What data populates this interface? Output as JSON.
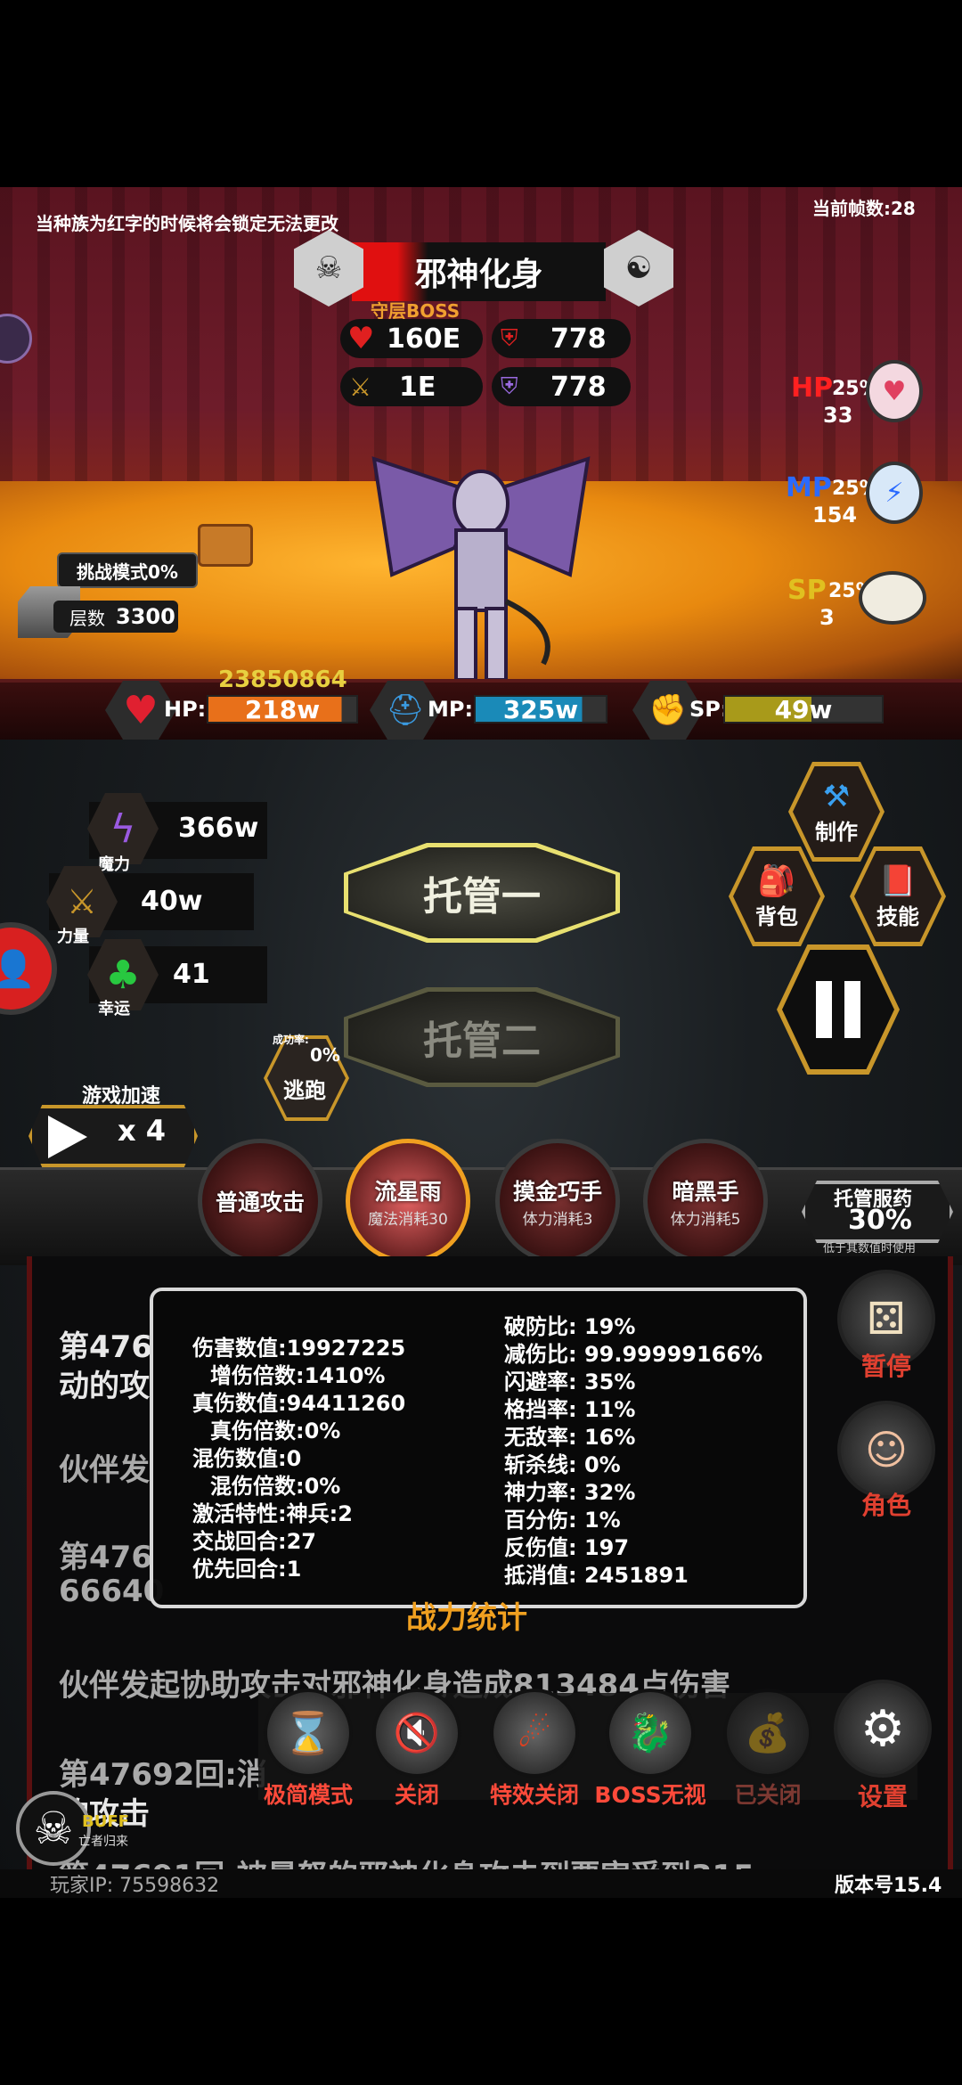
{
  "top_notice": "当种族为红字的时候将会锁定无法更改",
  "fps_label": "当前帧数:28",
  "boss": {
    "name": "邪神化身",
    "tag": "守层BOSS",
    "hp": "160E",
    "atk": "1E",
    "def1": "778",
    "def2": "778"
  },
  "potions": [
    {
      "type": "HP",
      "pct": "25%",
      "count": "33"
    },
    {
      "type": "MP",
      "pct": "25%",
      "count": "154"
    },
    {
      "type": "SP",
      "pct": "25%",
      "count": "3"
    }
  ],
  "challenge": {
    "mode": "挑战模式0%",
    "floor_label": "层数",
    "floor": "3300"
  },
  "player": {
    "score": "23850864",
    "hp_label": "HP:",
    "hp": "218w",
    "hp_fill": 0.9,
    "mp_label": "MP:",
    "mp": "325w",
    "mp_fill": 0.82,
    "sp_label": "SP:",
    "sp": "49w",
    "sp_fill": 0.55
  },
  "attributes": [
    {
      "label": "魔力",
      "value": "366w",
      "icon": "lightning-icon"
    },
    {
      "label": "力量",
      "value": "40w",
      "icon": "sword-icon"
    },
    {
      "label": "幸运",
      "value": "41",
      "icon": "clover-icon"
    }
  ],
  "auto": {
    "one": "托管一",
    "two": "托管二"
  },
  "escape": {
    "rate_label": "成功率:",
    "rate": "0%",
    "label": "逃跑"
  },
  "speed": {
    "label": "游戏加速",
    "value": "x 4"
  },
  "right_menu": {
    "craft": "制作",
    "bag": "背包",
    "skill": "技能"
  },
  "skills": [
    {
      "name": "普通攻击",
      "cost": ""
    },
    {
      "name": "流星雨",
      "cost": "魔法消耗30"
    },
    {
      "name": "摸金巧手",
      "cost": "体力消耗3"
    },
    {
      "name": "暗黑手",
      "cost": "体力消耗5"
    }
  ],
  "auto_potion": {
    "label": "托管服药",
    "value": "30%",
    "note": "低于其数值时使用"
  },
  "side_actions": {
    "pause": "暂停",
    "role": "角色"
  },
  "log_lines": [
    "第476",
    "动的攻",
    "伙伴发",
    "第476",
    "66640",
    "伙伴发起协助攻击对邪神化身造成813484点伤害",
    "第47692回:消",
    "的攻击",
    "第47691回:被暴怒的邪神化身攻击到要害受到315"
  ],
  "stats_panel": {
    "title": "战力统计",
    "left": [
      {
        "k": "伤害数值:",
        "v": "19927225"
      },
      {
        "k": "增伤倍数:",
        "v": "1410%"
      },
      {
        "k": "真伤数值:",
        "v": "94411260"
      },
      {
        "k": "真伤倍数:",
        "v": "0%"
      },
      {
        "k": "混伤数值:",
        "v": "0"
      },
      {
        "k": "混伤倍数:",
        "v": "0%"
      },
      {
        "k": "激活特性:",
        "v": "神兵:2"
      },
      {
        "k": "交战回合:",
        "v": "27"
      },
      {
        "k": "优先回合:",
        "v": "1"
      }
    ],
    "right": [
      {
        "k": "破防比:",
        "v": "19%"
      },
      {
        "k": "减伤比:",
        "v": "99.99999166%"
      },
      {
        "k": "闪避率:",
        "v": "35%"
      },
      {
        "k": "格挡率:",
        "v": "11%"
      },
      {
        "k": "无敌率:",
        "v": "16%"
      },
      {
        "k": "斩杀线:",
        "v": "0%"
      },
      {
        "k": "神力率:",
        "v": "32%"
      },
      {
        "k": "百分伤:",
        "v": "1%"
      },
      {
        "k": "反伤值:",
        "v": "197"
      },
      {
        "k": "抵消值:",
        "v": "2451891"
      }
    ]
  },
  "bottom_bar": [
    {
      "label": "极简模式",
      "icon": "hourglass-icon"
    },
    {
      "label": "关闭",
      "icon": "mute-icon"
    },
    {
      "label": "特效关闭",
      "icon": "flame-icon"
    },
    {
      "label": "BOSS无视",
      "icon": "dragon-icon"
    },
    {
      "label": "已关闭",
      "icon": "bag-icon"
    },
    {
      "label": "设置",
      "icon": "gear-icon"
    }
  ],
  "buff": {
    "label": "BUFF",
    "sub": "亡者归来"
  },
  "player_ip_label": "玩家IP:",
  "player_ip": "75598632",
  "version": "版本号15.4"
}
